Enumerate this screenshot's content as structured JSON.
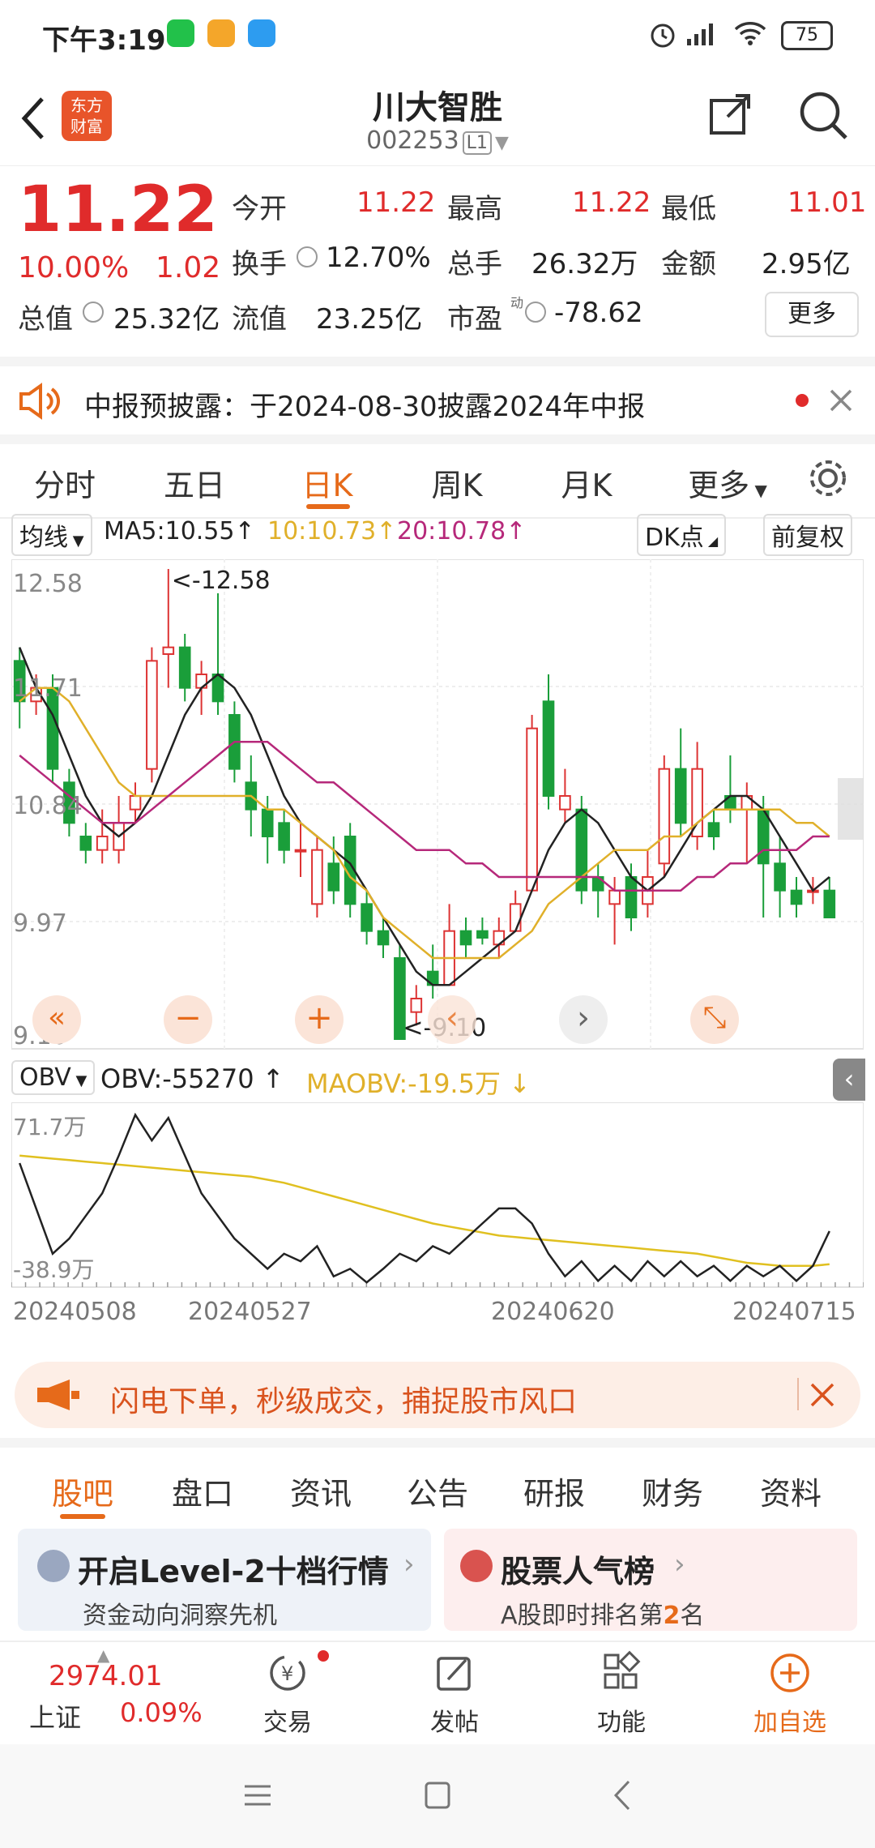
{
  "status_bar": {
    "time": "下午3:19",
    "battery": "75"
  },
  "header": {
    "title": "川大智胜",
    "code": "002253",
    "level": "L1",
    "logo_line1": "东方",
    "logo_line2": "财富"
  },
  "quote": {
    "price": "11.22",
    "pct": "10.00%",
    "change": "1.02",
    "open_label": "今开",
    "open": "11.22",
    "high_label": "最高",
    "high": "11.22",
    "low_label": "最低",
    "low": "11.01",
    "turnover_label": "换手",
    "turnover": "12.70%",
    "volume_label": "总手",
    "volume": "26.32万",
    "amount_label": "金额",
    "amount": "2.95亿",
    "mktcap_label": "总值",
    "mktcap": "25.32亿",
    "float_label": "流值",
    "float": "23.25亿",
    "pe_label": "市盈",
    "pe_sup": "动",
    "pe": "-78.62",
    "more": "更多"
  },
  "notice": {
    "text": "中报预披露：于2024-08-30披露2024年中报"
  },
  "chart_tabs": {
    "items": [
      "分时",
      "五日",
      "日K",
      "周K",
      "月K",
      "更多"
    ],
    "active": "日K"
  },
  "chart_toolbar": {
    "ma_select": "均线",
    "ma5": "MA5:10.55",
    "ma10": "10:10.73",
    "ma20": "20:10.78",
    "dk": "DK点",
    "adjust": "前复权"
  },
  "obv_toolbar": {
    "select": "OBV",
    "obv": "OBV:-55270",
    "maobv": "MAOBV:-19.5万"
  },
  "chart_data": [
    {
      "type": "candlestick",
      "y_ticks": [
        "12.58",
        "11.71",
        "10.84",
        "9.97",
        "9.10"
      ],
      "ylim": [
        9.1,
        12.58
      ],
      "annotations": {
        "max": "<-12.58",
        "min": "<-9.10"
      },
      "x_dates": [
        "20240508",
        "20240527",
        "20240620",
        "20240715"
      ],
      "candles": [
        [
          11.9,
          11.6,
          12.0,
          11.4
        ],
        [
          11.6,
          11.7,
          11.8,
          11.5
        ],
        [
          11.7,
          11.1,
          11.8,
          11.0
        ],
        [
          11.0,
          10.7,
          11.1,
          10.6
        ],
        [
          10.6,
          10.5,
          10.7,
          10.4
        ],
        [
          10.5,
          10.6,
          10.8,
          10.4
        ],
        [
          10.5,
          10.7,
          10.9,
          10.4
        ],
        [
          10.8,
          10.9,
          11.0,
          10.7
        ],
        [
          11.1,
          11.9,
          12.0,
          11.0
        ],
        [
          11.95,
          12.0,
          12.58,
          11.7
        ],
        [
          12.0,
          11.7,
          12.1,
          11.6
        ],
        [
          11.7,
          11.8,
          11.9,
          11.5
        ],
        [
          11.8,
          11.6,
          12.4,
          11.5
        ],
        [
          11.5,
          11.1,
          11.6,
          11.0
        ],
        [
          11.0,
          10.8,
          11.2,
          10.6
        ],
        [
          10.8,
          10.6,
          10.9,
          10.4
        ],
        [
          10.7,
          10.5,
          10.8,
          10.4
        ],
        [
          10.5,
          10.5,
          10.7,
          10.3
        ],
        [
          10.1,
          10.5,
          10.6,
          10.0
        ],
        [
          10.4,
          10.2,
          10.6,
          10.1
        ],
        [
          10.6,
          10.1,
          10.7,
          10.0
        ],
        [
          10.1,
          9.9,
          10.2,
          9.8
        ],
        [
          9.9,
          9.8,
          10.0,
          9.7
        ],
        [
          9.7,
          9.1,
          9.8,
          9.1
        ],
        [
          9.3,
          9.4,
          9.5,
          9.2
        ],
        [
          9.6,
          9.5,
          9.8,
          9.4
        ],
        [
          9.5,
          9.9,
          10.1,
          9.5
        ],
        [
          9.9,
          9.8,
          10.0,
          9.7
        ],
        [
          9.9,
          9.85,
          10.0,
          9.8
        ],
        [
          9.8,
          9.9,
          10.0,
          9.7
        ],
        [
          9.9,
          10.1,
          10.2,
          9.9
        ],
        [
          10.2,
          11.4,
          11.5,
          10.2
        ],
        [
          11.6,
          10.9,
          11.8,
          10.8
        ],
        [
          10.8,
          10.9,
          11.1,
          10.7
        ],
        [
          10.8,
          10.2,
          10.9,
          10.1
        ],
        [
          10.3,
          10.2,
          10.4,
          10.0
        ],
        [
          10.1,
          10.2,
          10.3,
          9.8
        ],
        [
          10.3,
          10.0,
          10.4,
          9.9
        ],
        [
          10.1,
          10.3,
          10.5,
          10.0
        ],
        [
          10.4,
          11.1,
          11.2,
          10.3
        ],
        [
          11.1,
          10.7,
          11.4,
          10.6
        ],
        [
          10.6,
          11.1,
          11.3,
          10.5
        ],
        [
          10.7,
          10.6,
          10.8,
          10.5
        ],
        [
          10.9,
          10.8,
          11.2,
          10.7
        ],
        [
          10.8,
          10.9,
          11.0,
          10.4
        ],
        [
          10.8,
          10.4,
          10.9,
          10.0
        ],
        [
          10.4,
          10.2,
          10.6,
          10.0
        ],
        [
          10.2,
          10.1,
          10.3,
          10.0
        ],
        [
          10.2,
          10.2,
          10.3,
          10.1
        ],
        [
          10.2,
          10.0,
          10.3,
          10.0
        ]
      ],
      "series": [
        {
          "name": "MA5",
          "color": "#222222",
          "values": [
            12.0,
            11.7,
            11.5,
            11.2,
            10.9,
            10.7,
            10.6,
            10.7,
            10.9,
            11.2,
            11.5,
            11.7,
            11.8,
            11.7,
            11.5,
            11.2,
            10.9,
            10.7,
            10.6,
            10.5,
            10.4,
            10.2,
            10.0,
            9.8,
            9.6,
            9.5,
            9.5,
            9.6,
            9.7,
            9.8,
            9.9,
            10.2,
            10.5,
            10.7,
            10.8,
            10.7,
            10.5,
            10.3,
            10.2,
            10.3,
            10.5,
            10.7,
            10.8,
            10.9,
            10.9,
            10.8,
            10.6,
            10.4,
            10.2,
            10.3
          ]
        },
        {
          "name": "MA10",
          "color": "#e0b02a",
          "values": [
            11.6,
            11.7,
            11.7,
            11.6,
            11.4,
            11.2,
            11.0,
            10.9,
            10.9,
            10.9,
            10.9,
            10.9,
            10.9,
            10.9,
            10.9,
            10.8,
            10.8,
            10.7,
            10.6,
            10.5,
            10.3,
            10.2,
            10.0,
            9.9,
            9.8,
            9.7,
            9.7,
            9.7,
            9.7,
            9.7,
            9.8,
            9.9,
            10.1,
            10.2,
            10.3,
            10.4,
            10.5,
            10.5,
            10.5,
            10.6,
            10.6,
            10.7,
            10.8,
            10.8,
            10.8,
            10.8,
            10.8,
            10.7,
            10.7,
            10.6
          ]
        },
        {
          "name": "MA20",
          "color": "#b6287a",
          "values": [
            11.2,
            11.1,
            11.0,
            10.9,
            10.8,
            10.7,
            10.7,
            10.7,
            10.8,
            10.9,
            11.0,
            11.1,
            11.2,
            11.3,
            11.3,
            11.3,
            11.2,
            11.1,
            11.0,
            11.0,
            10.9,
            10.8,
            10.7,
            10.6,
            10.5,
            10.5,
            10.5,
            10.4,
            10.4,
            10.3,
            10.3,
            10.3,
            10.3,
            10.3,
            10.3,
            10.3,
            10.2,
            10.2,
            10.2,
            10.2,
            10.2,
            10.3,
            10.3,
            10.4,
            10.4,
            10.5,
            10.5,
            10.5,
            10.6,
            10.6
          ]
        }
      ]
    },
    {
      "type": "line",
      "y_ticks": [
        "71.7万",
        "-38.9万"
      ],
      "ylim": [
        -38.9,
        71.7
      ],
      "series": [
        {
          "name": "OBV",
          "color": "#222222",
          "values": [
            40,
            10,
            -20,
            -10,
            5,
            20,
            45,
            72,
            55,
            70,
            45,
            20,
            5,
            -10,
            -20,
            -30,
            -20,
            -25,
            -15,
            -35,
            -30,
            -39,
            -30,
            -20,
            -25,
            -15,
            -20,
            -10,
            0,
            10,
            10,
            0,
            -20,
            -35,
            -25,
            -38,
            -28,
            -38,
            -25,
            -35,
            -25,
            -35,
            -28,
            -38,
            -28,
            -35,
            -28,
            -38,
            -28,
            -5
          ]
        },
        {
          "name": "MAOBV",
          "color": "#e0c020",
          "values": [
            45,
            44,
            43,
            42,
            41,
            40,
            39,
            38,
            37,
            36,
            35,
            34,
            33,
            32,
            31,
            29,
            27,
            24,
            21,
            18,
            15,
            12,
            9,
            6,
            3,
            0,
            -2,
            -4,
            -6,
            -8,
            -9,
            -10,
            -11,
            -12,
            -13,
            -14,
            -15,
            -16,
            -17,
            -18,
            -19,
            -20,
            -22,
            -24,
            -26,
            -27,
            -28,
            -28,
            -28,
            -27
          ]
        }
      ]
    }
  ],
  "chart_controls": {
    "prev": "«",
    "zoom_out": "−",
    "zoom_in": "+",
    "left": "‹",
    "right": "›",
    "expand": "⤡"
  },
  "banner": {
    "text": "闪电下单，秒级成交，捕捉股市风口"
  },
  "bottom_tabs": {
    "items": [
      "股吧",
      "盘口",
      "资讯",
      "公告",
      "研报",
      "财务",
      "资料"
    ],
    "active": "股吧"
  },
  "cards": [
    {
      "title": "开启Level-2十档行情",
      "sub": "资金动向洞察先机"
    },
    {
      "title": "股票人气榜",
      "sub_pre": "A股即时排名第",
      "sub_rank": "2",
      "sub_post": "名"
    }
  ],
  "navbar": {
    "index_value": "2974.01",
    "index_name": "上证",
    "index_pct": "0.09%",
    "trade": "交易",
    "post": "发帖",
    "func": "功能",
    "add": "加自选"
  }
}
